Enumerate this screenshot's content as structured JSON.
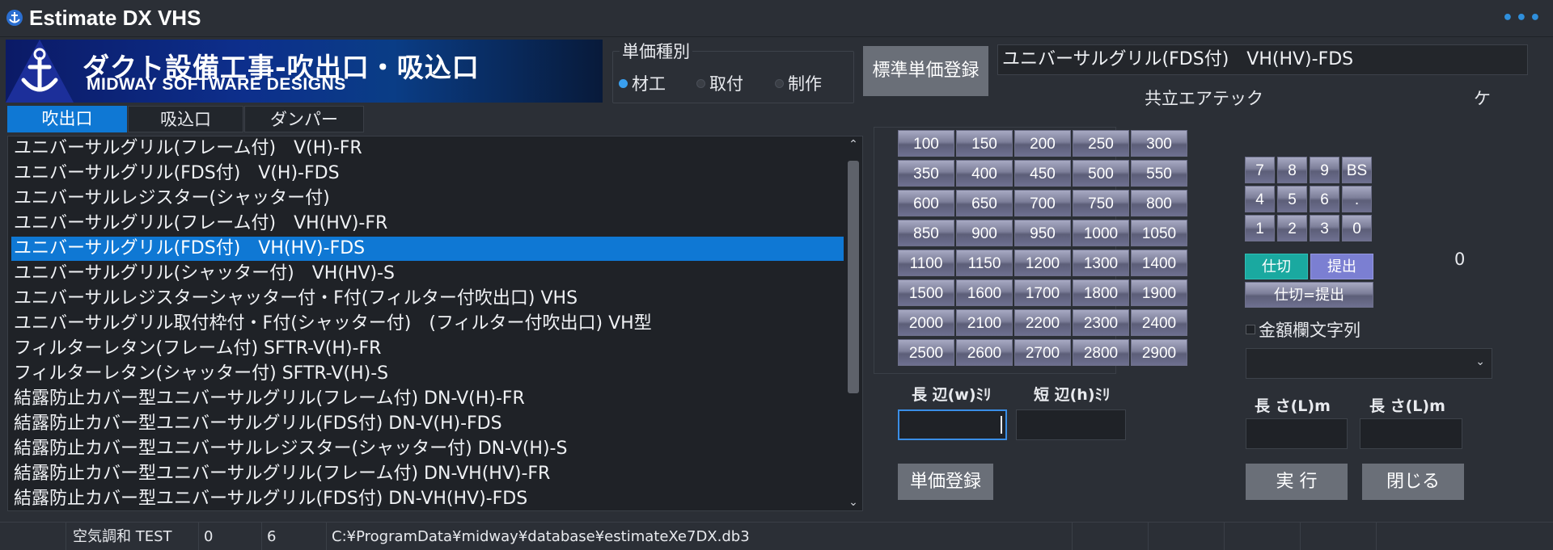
{
  "app": {
    "title": "Estimate DX VHS",
    "menu_dots": "•••"
  },
  "banner": {
    "title": "ダクト設備工事-吹出口・吸込口",
    "subtitle": "MIDWAY SOFTWARE DESIGNS"
  },
  "tabs": [
    {
      "label": "吹出口",
      "active": true
    },
    {
      "label": "吸込口",
      "active": false
    },
    {
      "label": "ダンパー",
      "active": false
    }
  ],
  "product_list": {
    "selected_index": 4,
    "items": [
      "ユニバーサルグリル(フレーム付)　V(H)-FR",
      "ユニバーサルグリル(FDS付)　V(H)-FDS",
      "ユニバーサルレジスター(シャッター付)",
      "ユニバーサルグリル(フレーム付)　VH(HV)-FR",
      "ユニバーサルグリル(FDS付)　VH(HV)-FDS",
      "ユニバーサルグリル(シャッター付)　VH(HV)-S",
      "ユニバーサルレジスターシャッター付・F付(フィルター付吹出口) VHS",
      "ユニバーサルグリル取付枠付・F付(シャッター付)　(フィルター付吹出口) VH型",
      "フィルターレタン(フレーム付) SFTR-V(H)-FR",
      "フィルターレタン(シャッター付) SFTR-V(H)-S",
      "結露防止カバー型ユニバーサルグリル(フレーム付) DN-V(H)-FR",
      "結露防止カバー型ユニバーサルグリル(FDS付) DN-V(H)-FDS",
      "結露防止カバー型ユニバーサルレジスター(シャッター付) DN-V(H)-S",
      "結露防止カバー型ユニバーサルグリル(フレーム付) DN-VH(HV)-FR",
      "結露防止カバー型ユニバーサルグリル(FDS付) DN-VH(HV)-FDS"
    ]
  },
  "unit_type": {
    "label": "単価種別",
    "options": [
      {
        "label": "材工",
        "selected": true
      },
      {
        "label": "取付",
        "selected": false
      },
      {
        "label": "制作",
        "selected": false
      }
    ]
  },
  "std_price_button": "標準単価登録",
  "selected_name": "ユニバーサルグリル(FDS付)　VH(HV)-FDS",
  "maker": "共立エアテック",
  "unit": "ケ",
  "size_buttons": [
    "100",
    "150",
    "200",
    "250",
    "300",
    "350",
    "400",
    "450",
    "500",
    "550",
    "600",
    "650",
    "700",
    "750",
    "800",
    "850",
    "900",
    "950",
    "1000",
    "1050",
    "1100",
    "1150",
    "1200",
    "1300",
    "1400",
    "1500",
    "1600",
    "1700",
    "1800",
    "1900",
    "2000",
    "2100",
    "2200",
    "2300",
    "2400",
    "2500",
    "2600",
    "2700",
    "2800",
    "2900"
  ],
  "numpad": [
    "7",
    "8",
    "9",
    "BS",
    "4",
    "5",
    "6",
    ".",
    "1",
    "2",
    "3",
    "0"
  ],
  "shikiri": "仕切",
  "teishutsu": "提出",
  "shikiri_eq": "仕切=提出",
  "amount": "0",
  "amount_text_checkbox": "金額欄文字列",
  "fields": {
    "long_side_label": "長  辺(w)ﾐﾘ",
    "short_side_label": "短  辺(h)ﾐﾘ",
    "length1_label": "長  さ(L)m",
    "length2_label": "長  さ(L)m"
  },
  "buttons": {
    "register": "単価登録",
    "execute": "実  行",
    "close": "閉じる"
  },
  "status": {
    "category": "空気調和 TEST",
    "val1": "0",
    "val2": "6",
    "path": "C:¥ProgramData¥midway¥database¥estimateXe7DX.db3"
  },
  "colors": {
    "accent": "#0f78d4",
    "shikiri": "#1aa9a0",
    "teishutsu": "#7b7fd2",
    "background": "#2b2f36"
  }
}
